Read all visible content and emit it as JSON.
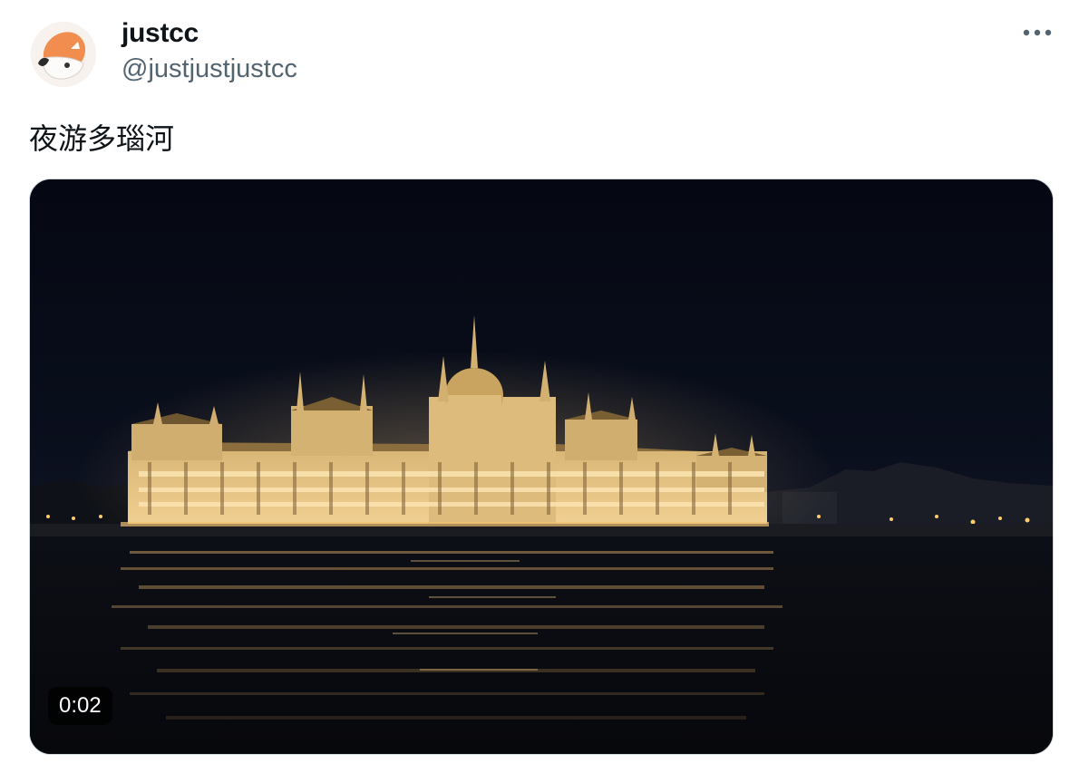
{
  "author": {
    "name": "justcc",
    "handle": "@justjustjustcc",
    "avatar_icon": "avatar-illustration"
  },
  "tweet": {
    "text": "夜游多瑙河"
  },
  "media": {
    "type": "video",
    "duration_display": "0:02",
    "scene": "night-city-river-view"
  },
  "menu": {
    "icon": "more-horizontal-icon"
  },
  "colors": {
    "text_primary": "#0f1419",
    "text_secondary": "#536471",
    "border": "#cfd9de"
  }
}
